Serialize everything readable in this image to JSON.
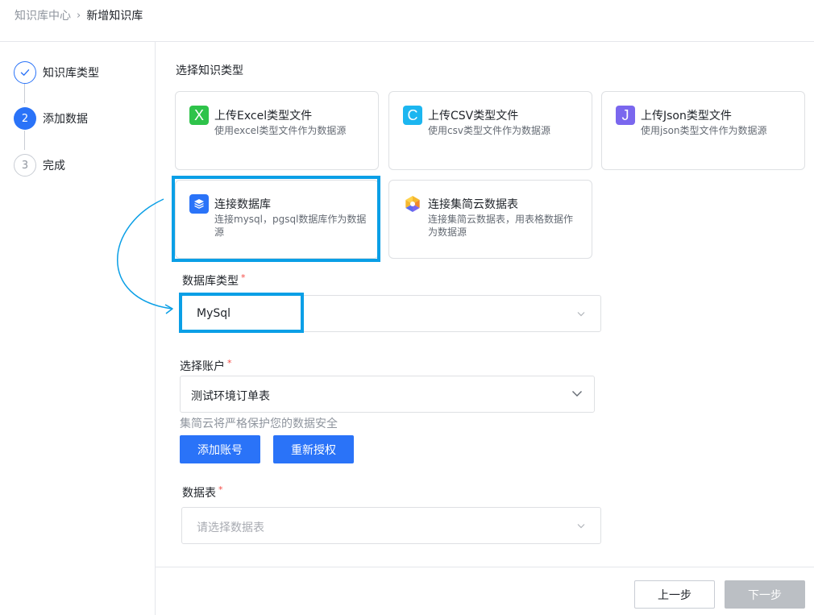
{
  "breadcrumb": {
    "parent": "知识库中心",
    "separator": "›",
    "current": "新增知识库"
  },
  "steps": [
    {
      "label": "知识库类型",
      "state": "done",
      "marker": "✓"
    },
    {
      "label": "添加数据",
      "state": "active",
      "marker": "2"
    },
    {
      "label": "完成",
      "state": "todo",
      "marker": "3"
    }
  ],
  "main": {
    "section_title": "选择知识类型",
    "cards": [
      {
        "title": "上传Excel类型文件",
        "desc": "使用excel类型文件作为数据源",
        "icon": "X",
        "icon_name": "excel-icon",
        "color": "#2ec34a"
      },
      {
        "title": "上传CSV类型文件",
        "desc": "使用csv类型文件作为数据源",
        "icon": "C",
        "icon_name": "csv-icon",
        "color": "#1cb6f0"
      },
      {
        "title": "上传Json类型文件",
        "desc": "使用json类型文件作为数据源",
        "icon": "J",
        "icon_name": "json-icon",
        "color": "#7a67ee"
      },
      {
        "title": "连接数据库",
        "desc": "连接mysql，pgsql数据库作为数据源",
        "icon": "",
        "icon_name": "database-layers-icon",
        "color": "#2a73f8",
        "selected": true
      },
      {
        "title": "连接集简云数据表",
        "desc": "连接集简云数据表，用表格数据作为数据源",
        "icon": "",
        "icon_name": "jijianyun-logo-icon",
        "color": "#f5b82e"
      }
    ]
  },
  "form": {
    "db_type": {
      "label": "数据库类型",
      "required": "*",
      "value": "MySql"
    },
    "account": {
      "label": "选择账户",
      "required": "*",
      "value": "测试环境订单表",
      "hint": "集简云将严格保护您的数据安全"
    },
    "add_account_label": "添加账号",
    "reauth_label": "重新授权",
    "table": {
      "label": "数据表",
      "required": "*",
      "placeholder": "请选择数据表"
    }
  },
  "footer": {
    "prev_label": "上一步",
    "next_label": "下一步"
  },
  "colors": {
    "primary": "#2a73f8",
    "highlight": "#0a9fe6",
    "required": "#f54a45"
  }
}
